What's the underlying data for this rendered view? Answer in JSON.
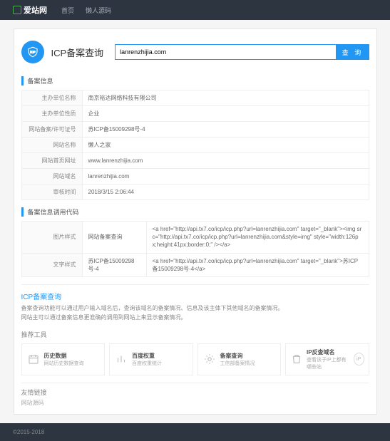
{
  "nav": {
    "brand": "爱站网",
    "links": [
      "首页",
      "懒人源码"
    ]
  },
  "search": {
    "title": "ICP备案查询",
    "value": "lanrenzhijia.com",
    "btn": "查 询"
  },
  "info_hdr": "备案信息",
  "info": [
    {
      "k": "主办单位名称",
      "v": "南京裕达网络科技有限公司"
    },
    {
      "k": "主办单位性质",
      "v": "企业"
    },
    {
      "k": "网站备案/许可证号",
      "v": "苏ICP备15009298号-4"
    },
    {
      "k": "网站名称",
      "v": "懒人之家"
    },
    {
      "k": "网站首页网址",
      "v": "www.lanrenzhijia.com"
    },
    {
      "k": "网站域名",
      "v": "lanrenzhijia.com"
    },
    {
      "k": "审核时间",
      "v": "2018/3/15 2:06:44"
    }
  ],
  "code_hdr": "备案信息调用代码",
  "code": [
    {
      "k": "图片样式",
      "v1": "网站备案查询",
      "v2": "<a href=\"http://api.tx7.co/icp/icp.php?url=lanrenzhijia.com\" target=\"_blank\"><img src=\"http://api.tx7.co/icp/icp.php?url=lanrenzhijia.com&style=img\" style=\"width:126px;height:41px;border:0;\" /></a>"
    },
    {
      "k": "文字样式",
      "v1": "苏ICP备15009298号-4",
      "v2": "<a href=\"http://api.tx7.co/icp/icp.php?url=lanrenzhijia.com\" target=\"_blank\">苏ICP备15009298号-4</a>"
    }
  ],
  "desc": {
    "title": "ICP备案查询",
    "lines": [
      "备案查询功能可以通过用户输入域名后，查询该域名的备案情况、信息及该主体下其他域名的备案情况。",
      "网站主可以通过备案信息更准确的调用到网站上来显示备案情况。"
    ]
  },
  "tools_hdr": "推荐工具",
  "tools": [
    {
      "t": "历史数据",
      "s": "网站历史数据查询"
    },
    {
      "t": "百度权重",
      "s": "百度权重统计"
    },
    {
      "t": "备案查询",
      "s": "工信部备案情况"
    },
    {
      "t": "IP反查域名",
      "s": "查看该子IP上都有哪些站"
    }
  ],
  "links": {
    "title": "友情链接",
    "item": "网站源码"
  },
  "footer": "©2015-2018"
}
